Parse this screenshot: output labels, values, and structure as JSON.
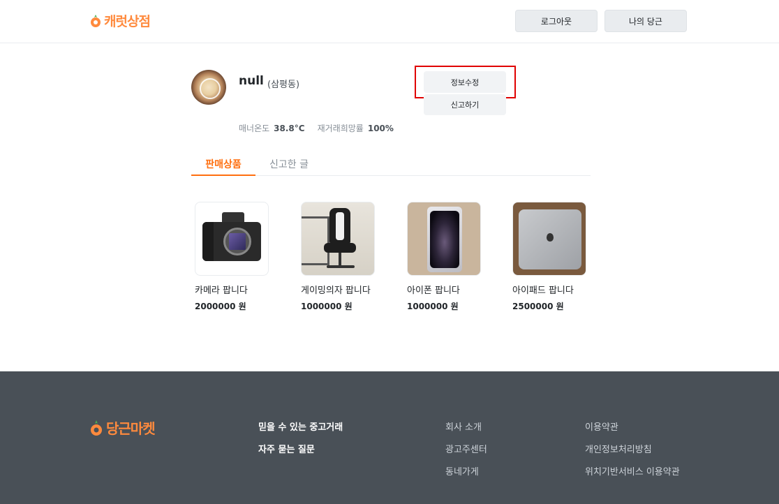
{
  "header": {
    "logo_text": "캐럿상점",
    "logout_label": "로그아웃",
    "my_carrot_label": "나의 당근"
  },
  "profile": {
    "name": "null",
    "region": "(삼평동)",
    "edit_label": "정보수정",
    "report_label": "신고하기",
    "manner_label": "매너온도",
    "manner_value": "38.8°C",
    "rehire_label": "재거래희망률",
    "rehire_value": "100%"
  },
  "tabs": [
    {
      "label": "판매상품",
      "active": true
    },
    {
      "label": "신고한 글",
      "active": false
    }
  ],
  "products": [
    {
      "title": "카메라 팝니다",
      "price": "2000000 원",
      "image": "camera"
    },
    {
      "title": "게이밍의자 팝니다",
      "price": "1000000 원",
      "image": "gaming-chair"
    },
    {
      "title": "아이폰 팝니다",
      "price": "1000000 원",
      "image": "iphone"
    },
    {
      "title": "아이패드 팝니다",
      "price": "2500000 원",
      "image": "ipad"
    }
  ],
  "footer": {
    "logo_text": "당근마켓",
    "col1": [
      "믿을 수 있는 중고거래",
      "자주 묻는 질문"
    ],
    "col2": [
      "회사 소개",
      "광고주센터",
      "동네가게"
    ],
    "col3": [
      "이용약관",
      "개인정보처리방침",
      "위치기반서비스 이용약관"
    ]
  },
  "colors": {
    "brand": "#ff6f0f",
    "footer_bg": "#495057",
    "highlight": "#e00000"
  }
}
